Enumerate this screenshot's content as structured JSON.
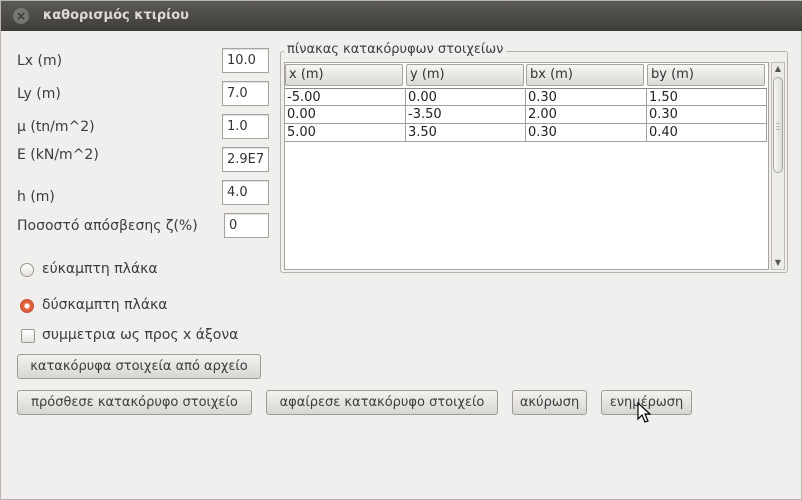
{
  "window": {
    "title": "καθορισμός κτιρίου"
  },
  "fields": [
    {
      "label": "Lx (m)",
      "value": "10.0"
    },
    {
      "label": "Ly (m)",
      "value": "7.0"
    },
    {
      "label": "μ (tn/m^2)",
      "value": "1.0"
    },
    {
      "label": "E (kN/m^2)",
      "value": "2.9E7"
    },
    {
      "label": "h (m)",
      "value": "4.0"
    },
    {
      "label": "Ποσοστό απόσβεσης ζ(%)",
      "value": "0"
    }
  ],
  "table": {
    "title": "πίνακας κατακόρυφων στοιχείων",
    "columns": [
      "x (m)",
      "y (m)",
      "bx (m)",
      "by (m)"
    ],
    "rows": [
      [
        "-5.00",
        "0.00",
        "0.30",
        "1.50"
      ],
      [
        "0.00",
        "-3.50",
        "2.00",
        "0.30"
      ],
      [
        "5.00",
        "3.50",
        "0.30",
        "0.40"
      ]
    ]
  },
  "options": {
    "flexible_slab": "εύκαμπτη πλάκα",
    "rigid_slab": "δύσκαμπτη πλάκα",
    "selected": "rigid_slab",
    "symmetry_x": "συμμετρια ως προς x άξονα",
    "symmetry_x_checked": false
  },
  "buttons": {
    "from_file": "κατακόρυφα στοιχεία από αρχείο",
    "add": "πρόσθεσε κατακόρυφο στοιχείο",
    "remove": "αφαίρεσε κατακόρυφο στοιχείο",
    "cancel": "ακύρωση",
    "update": "ενημέρωση"
  },
  "colors": {
    "titlebar": "#3e3d39",
    "radio_accent": "#e86b47",
    "window_bg": "#f0efed"
  }
}
